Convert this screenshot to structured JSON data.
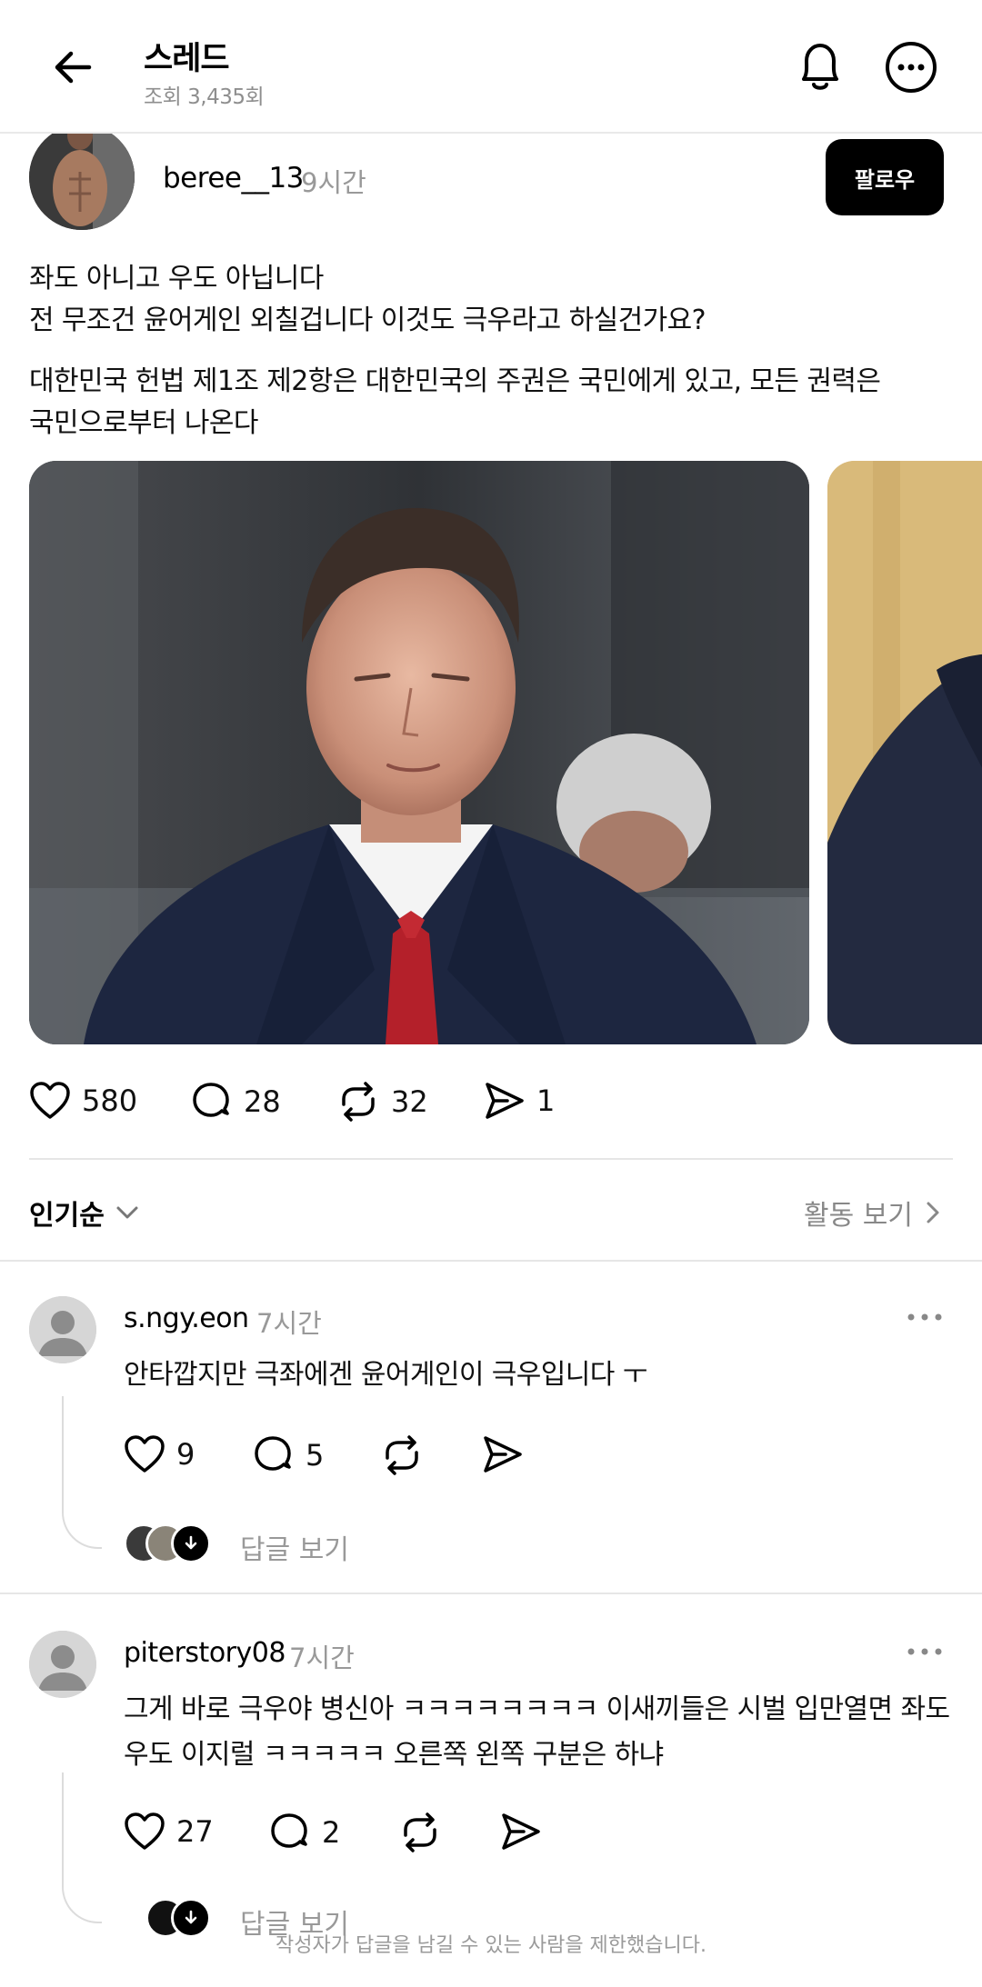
{
  "header": {
    "title": "스레드",
    "views": "조회 3,435회"
  },
  "post": {
    "author": "beree__13",
    "time": "9시간",
    "follow_label": "팔로우",
    "paragraph1": [
      "좌도 아니고 우도 아닙니다",
      "전 무조건 윤어게인 외칠겁니다 이것도 극우라고 하실건가요?"
    ],
    "paragraph2": [
      "대한민국 헌법 제1조 제2항은 대한민국의 주권은 국민에게 있고, 모든 권력은",
      "국민으로부터 나온다"
    ],
    "likes": "580",
    "comments": "28",
    "reposts": "32",
    "shares": "1"
  },
  "sort": {
    "label": "인기순",
    "activity_label": "활동 보기"
  },
  "comments": [
    {
      "author": "s.ngy.eon",
      "time": "7시간",
      "text": "안타깝지만 극좌에겐 윤어게인이 극우입니다 ㅜ",
      "likes": "9",
      "replies": "5",
      "view_replies": "답글 보기"
    },
    {
      "author": "piterstory08",
      "time": "7시간",
      "text_lines": [
        "그게 바로 극우야 병신아 ㅋㅋㅋㅋㅋㅋㅋㅋ 이새끼들은 시벌 입만열면 좌도",
        "우도 이지럴 ㅋㅋㅋㅋㅋ 오른쪽 왼쪽 구분은 하냐"
      ],
      "likes": "27",
      "replies": "2",
      "view_replies": "답글 보기"
    }
  ],
  "footer_note": "작성자가 답글을 남길 수 있는 사람을 제한했습니다.",
  "icons": [
    "back-arrow-icon",
    "bell-icon",
    "more-circle-icon",
    "heart-icon",
    "comment-icon",
    "repost-icon",
    "share-icon",
    "chevron-down-icon",
    "chevron-right-icon",
    "ellipsis-icon",
    "user-placeholder-icon",
    "arrow-down-circle-icon"
  ],
  "colors": {
    "follow_bg": "#000000",
    "muted_text": "#999999",
    "divider": "#e6e6e6"
  }
}
